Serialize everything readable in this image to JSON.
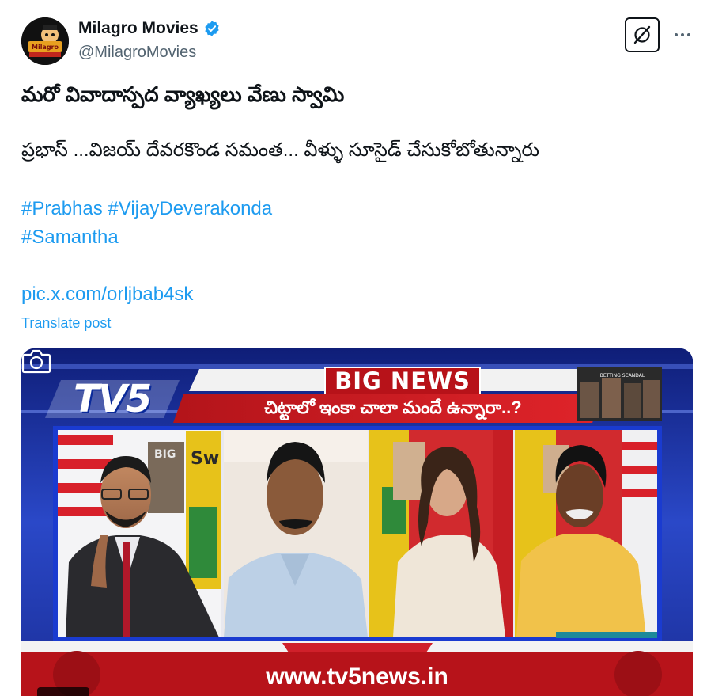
{
  "post": {
    "author_name": "Milagro Movies",
    "author_handle": "@MilagroMovies",
    "avatar_label": "Milagro",
    "title": "మరో వివాదాస్పద వ్యాఖ్యలు వేణు స్వామి",
    "body": "ప్రభాస్ ...విజయ్ దేవరకొండ సమంత... వీళ్ళు సూసైడ్ చేసుకోబోతున్నారు",
    "hashtags_line1": [
      "#Prabhas",
      "#VijayDeverakonda"
    ],
    "hashtags_line2": [
      "#Samantha"
    ],
    "link": "pic.x.com/orljbab4sk",
    "translate_label": "Translate post"
  },
  "media": {
    "channel": "TV5",
    "banner_title": "BIG NEWS",
    "ticker": "చిట్టాలో ఇంకా చాలా మందే ఉన్నారా..?",
    "promo_caption": "BETTING SCANDAL",
    "set_sign": "BIG",
    "footer_url": "www.tv5news.in"
  },
  "colors": {
    "link_blue": "#1d9bf0",
    "text": "#0f1419",
    "muted": "#536471",
    "verified": "#1d9bf0"
  }
}
